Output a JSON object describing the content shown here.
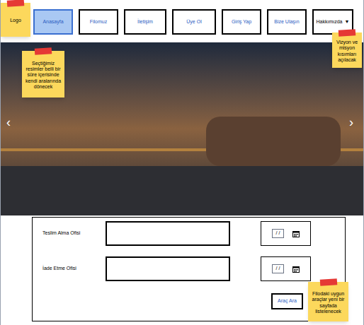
{
  "logo_note": "Logo",
  "nav": [
    {
      "label": "Anasayfa",
      "selected": true
    },
    {
      "label": "Filomuz",
      "selected": false
    },
    {
      "label": "İletişim",
      "selected": false
    },
    {
      "label": "Üye Ol",
      "selected": false
    },
    {
      "label": "Giriş Yap",
      "selected": false
    },
    {
      "label": "Bize Ulaşın",
      "selected": false
    },
    {
      "label": "Hakkımızda",
      "selected": false,
      "caret": "▼"
    }
  ],
  "about_note": "Vizyon ve misyon kısımları açılacak",
  "carousel": {
    "prev": "‹",
    "next": "›",
    "note": "Seçtiğimiz resimler belli bir süre içerisinde kendi aralarında dönecek"
  },
  "form": {
    "rows": [
      {
        "label": "Teslim Alma Ofisi",
        "date": "/ /"
      },
      {
        "label": "İade Etme Ofisi",
        "date": "/ /"
      }
    ],
    "button": "Araç Ara",
    "note": "Filodaki uygun araçlar yeni bir sayfada listelenecek"
  }
}
